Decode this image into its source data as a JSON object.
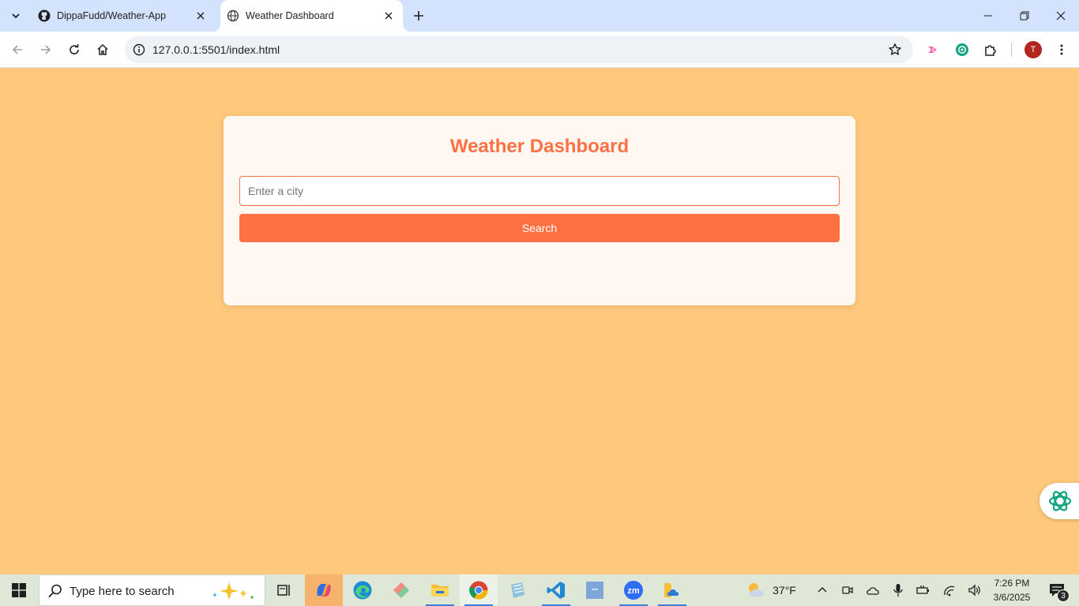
{
  "browser": {
    "tabs": [
      {
        "title": "DippaFudd/Weather-App",
        "active": false,
        "favicon": "github-icon"
      },
      {
        "title": "Weather Dashboard",
        "active": true,
        "favicon": "globe-icon"
      }
    ],
    "url": "127.0.0.1:5501/index.html",
    "profile_initial": "T"
  },
  "page": {
    "title": "Weather Dashboard",
    "search": {
      "placeholder": "Enter a city",
      "value": ""
    },
    "search_button_label": "Search",
    "colors": {
      "background": "#ffc97d",
      "accent": "#ff7043",
      "card": "#fff8f2"
    }
  },
  "taskbar": {
    "search_placeholder": "Type here to search",
    "apps": [
      "task-view",
      "copilot",
      "edge",
      "pinned-app",
      "file-explorer",
      "chrome",
      "notepad",
      "vscode",
      "app",
      "zoom",
      "onedrive"
    ],
    "weather": {
      "temp": "37°F",
      "icon": "partly-cloudy-icon"
    },
    "clock": {
      "time": "7:26 PM",
      "date": "3/6/2025"
    },
    "notifications": "3"
  }
}
